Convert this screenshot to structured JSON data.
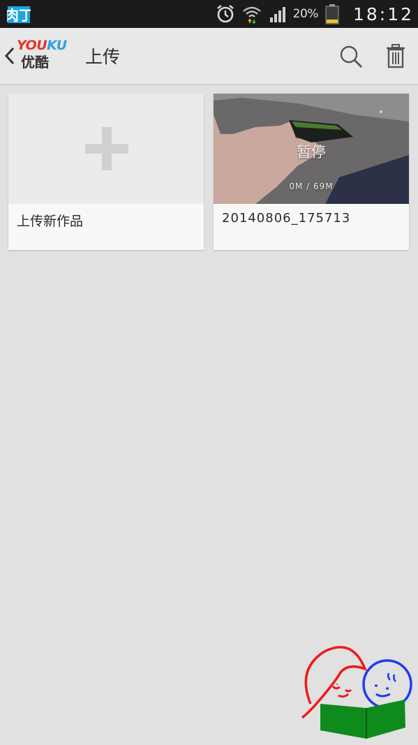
{
  "status_bar": {
    "app_badge_text": "肉丁",
    "battery_percent": "20%",
    "time": "18:12",
    "icons": [
      "app-badge-icon",
      "alarm-icon",
      "wifi-icon",
      "signal-icon",
      "battery-icon"
    ]
  },
  "action_bar": {
    "back_icon": "chevron-left-icon",
    "logo_text_top_red": "YOU",
    "logo_text_top_blue": "KU",
    "logo_text_bottom": "优酷",
    "title": "上传",
    "actions": [
      "search-icon",
      "trash-icon"
    ]
  },
  "cards": {
    "new_upload": {
      "label": "上传新作品",
      "icon": "plus-icon"
    },
    "video": {
      "overlay_status": "暂停",
      "progress": "0M / 69M",
      "filename": "20140806_175713"
    }
  },
  "colors": {
    "status_bar_bg": "#1b1b1b",
    "action_bar_bg": "#e8e8e8",
    "page_bg": "#e1e1e1",
    "logo_red": "#e2372c",
    "logo_blue": "#2da1e0"
  }
}
